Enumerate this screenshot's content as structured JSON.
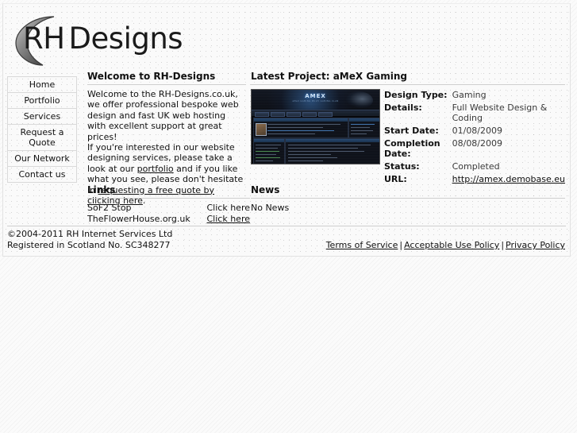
{
  "site": {
    "logo_primary": "RH",
    "logo_secondary": "Designs",
    "logo_icon": "crescent-moon-icon"
  },
  "nav": {
    "items": [
      {
        "label": "Home"
      },
      {
        "label": "Portfolio"
      },
      {
        "label": "Services"
      },
      {
        "label": "Request a Quote"
      },
      {
        "label": "Our Network"
      },
      {
        "label": "Contact us"
      }
    ]
  },
  "welcome": {
    "heading": "Welcome to RH-Designs",
    "para1_a": "Welcome to the RH-Designs.co.uk, we offer professional bespoke web design and fast UK web hosting with excellent support at great prices!",
    "para2_a": "If you're interested in our website designing services, please take a look at our ",
    "link_portfolio": "portfolio",
    "para2_b": " and if you like what you see, please don't hesitate in ",
    "link_quote": "requesting a free quote by clicking here",
    "para2_c": "."
  },
  "project": {
    "heading": "Latest Project: aMeX Gaming",
    "thumbnail_alt": "amex-gaming-site-screenshot",
    "thumb": {
      "site_logo": "AMEX",
      "site_tagline": "aMeX GAMING MULTI GAMING CLAN"
    },
    "rows": [
      {
        "key": "Design Type:",
        "value": "Gaming",
        "is_link": false
      },
      {
        "key": "Details:",
        "value": "Full Website Design & Coding",
        "is_link": false
      },
      {
        "key": "Start Date:",
        "value": "01/08/2009",
        "is_link": false
      },
      {
        "key": "Completion Date:",
        "value": "08/08/2009",
        "is_link": false
      },
      {
        "key": "Status:",
        "value": "Completed",
        "is_link": false
      },
      {
        "key": "URL:",
        "value": "http://amex.demobase.eu",
        "is_link": true
      }
    ]
  },
  "links": {
    "heading": "Links",
    "items": [
      {
        "name": "SoF2 Stop",
        "action": "Click here",
        "underlined": false
      },
      {
        "name": "TheFlowerHouse.org.uk",
        "action": "Click here",
        "underlined": true
      }
    ]
  },
  "news": {
    "heading": "News",
    "body": "No News"
  },
  "footer": {
    "copyright_line1": "©2004-2011 RH Internet Services Ltd",
    "copyright_line2": "Registered in Scotland No. SC348277",
    "links": [
      {
        "label": "Terms of Service"
      },
      {
        "label": "Acceptable Use Policy"
      },
      {
        "label": "Privacy Policy"
      }
    ],
    "separator": "|"
  }
}
